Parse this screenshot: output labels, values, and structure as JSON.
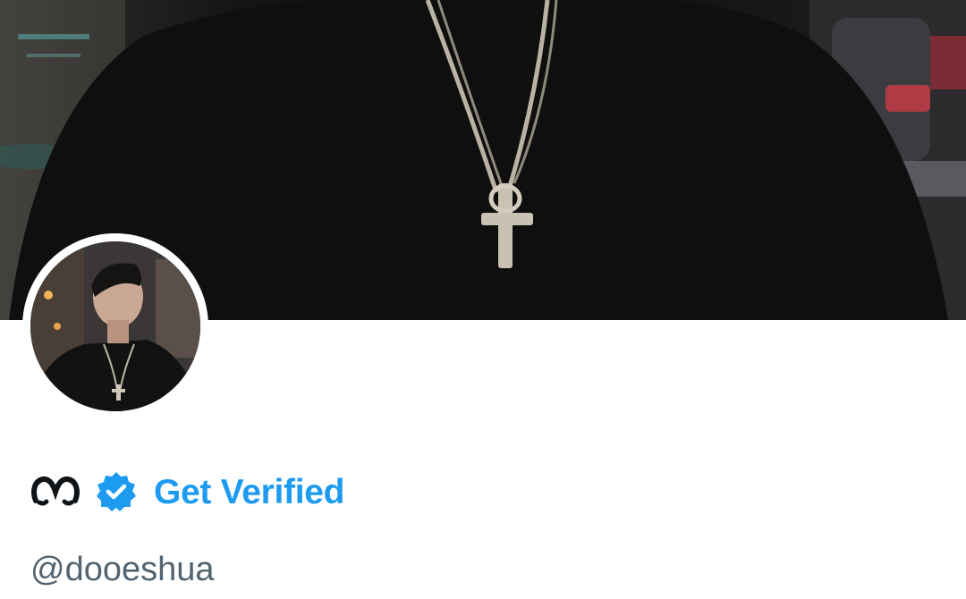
{
  "profile": {
    "display_name_icon": "cursive-letter-m-icon",
    "verified_icon": "verified-badge-icon",
    "get_verified_label": "Get Verified",
    "handle": "@dooeshua"
  },
  "colors": {
    "accent": "#1d9bf0",
    "handle_text": "#536471",
    "background": "#ffffff"
  }
}
